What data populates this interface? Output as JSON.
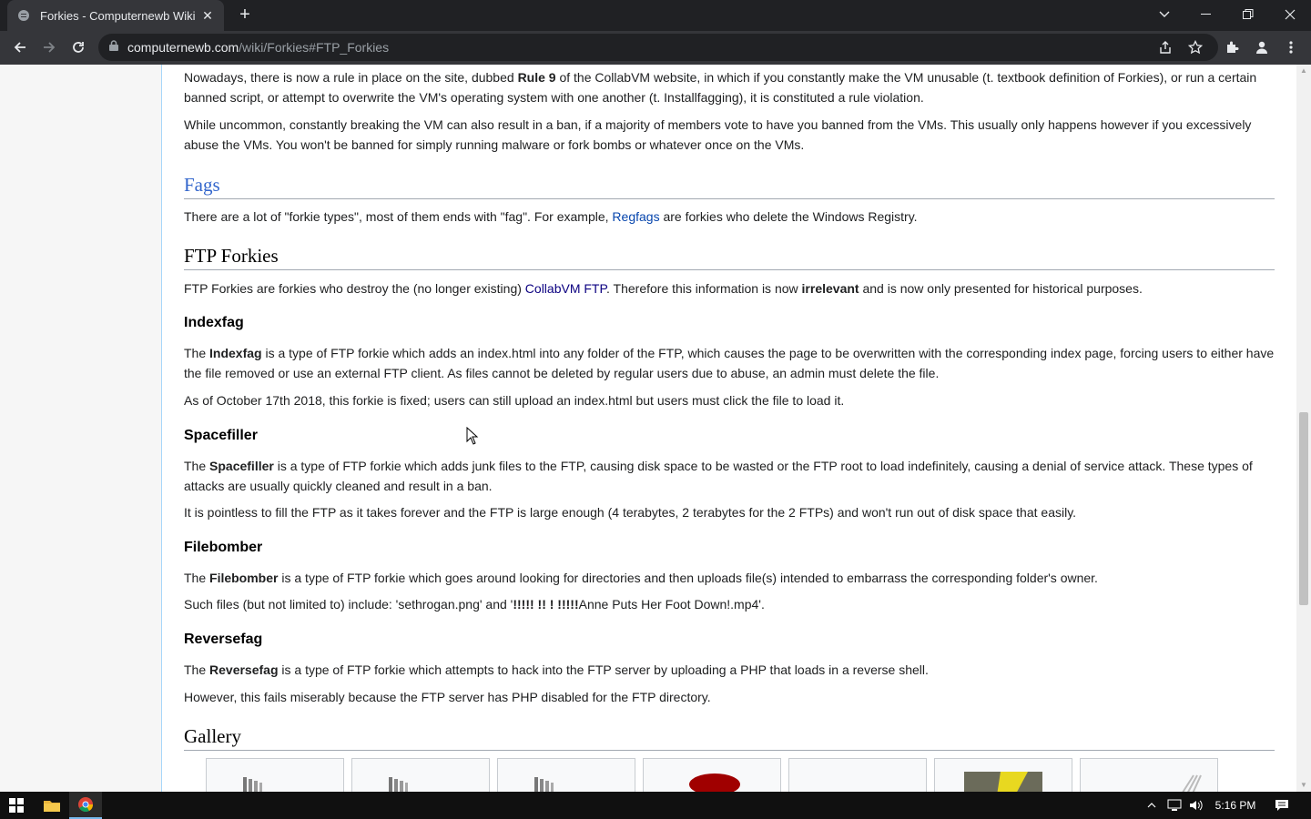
{
  "browser": {
    "tab_title": "Forkies - Computernewb Wiki",
    "url_host": "computernewb.com",
    "url_path": "/wiki/Forkies#FTP_Forkies"
  },
  "article": {
    "p_rules_1": "Nowadays, there is now a rule in place on the site, dubbed ",
    "p_rules_bold": "Rule 9",
    "p_rules_2": " of the CollabVM website, in which if you constantly make the VM unusable (t. textbook definition of Forkies), or run a certain banned script, or attempt to overwrite the VM's operating system with one another (t. Installfagging), it is constituted a rule violation.",
    "p_ban": "While uncommon, constantly breaking the VM can also result in a ban, if a majority of members vote to have you banned from the VMs. This usually only happens however if you excessively abuse the VMs. You won't be banned for simply running malware or fork bombs or whatever once on the VMs.",
    "h_fags": "Fags",
    "p_fags_1": "There are a lot of \"forkie types\", most of them ends with \"fag\". For example, ",
    "p_fags_link": "Regfags",
    "p_fags_2": " are forkies who delete the Windows Registry.",
    "h_ftp": "FTP Forkies",
    "p_ftp_1": "FTP Forkies are forkies who destroy the (no longer existing) ",
    "p_ftp_link": "CollabVM FTP",
    "p_ftp_2": ". Therefore this information is now ",
    "p_ftp_bold": "irrelevant",
    "p_ftp_3": " and is now only presented for historical purposes.",
    "h_indexfag": "Indexfag",
    "p_index_1a": "The ",
    "p_index_bold": "Indexfag",
    "p_index_1b": " is a type of FTP forkie which adds an index.html into any folder of the FTP, which causes the page to be overwritten with the corresponding index page, forcing users to either have the file removed or use an external FTP client. As files cannot be deleted by regular users due to abuse, an admin must delete the file.",
    "p_index_2": "As of October 17th 2018, this forkie is fixed; users can still upload an index.html but users must click the file to load it.",
    "h_spacefiller": "Spacefiller",
    "p_space_1a": "The ",
    "p_space_bold": "Spacefiller",
    "p_space_1b": " is a type of FTP forkie which adds junk files to the FTP, causing disk space to be wasted or the FTP root to load indefinitely, causing a denial of service attack. These types of attacks are usually quickly cleaned and result in a ban.",
    "p_space_2": "It is pointless to fill the FTP as it takes forever and the FTP is large enough (4 terabytes, 2 terabytes for the 2 FTPs) and won't run out of disk space that easily.",
    "h_filebomber": "Filebomber",
    "p_file_1a": "The ",
    "p_file_bold": "Filebomber",
    "p_file_1b": " is a type of FTP forkie which goes around looking for directories and then uploads file(s) intended to embarrass the corresponding folder's owner.",
    "p_file_2a": "Such files (but not limited to) include: 'sethrogan.png' and '",
    "p_file_2bold": "!!!!! !! ! !!!!!",
    "p_file_2b": "Anne Puts Her Foot Down!.mp4'.",
    "h_reversefag": "Reversefag",
    "p_rev_1a": "The ",
    "p_rev_bold": "Reversefag",
    "p_rev_1b": " is a type of FTP forkie which attempts to hack into the FTP server by uploading a PHP that loads in a reverse shell.",
    "p_rev_2": "However, this fails miserably because the FTP server has PHP disabled for the FTP directory.",
    "h_gallery": "Gallery"
  },
  "taskbar": {
    "time": "5:16 PM"
  },
  "colors": {
    "link": "#0645ad",
    "chrome_dark": "#202124",
    "chrome_tab": "#35363a"
  }
}
